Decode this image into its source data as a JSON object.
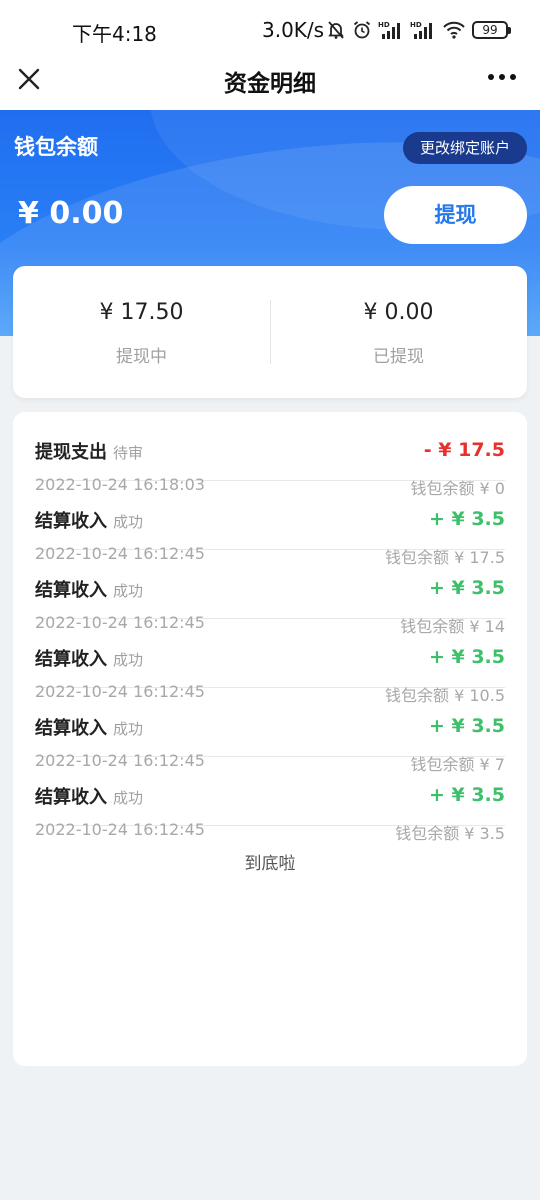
{
  "status_bar": {
    "time": "下午4:18",
    "net_speed": "3.0K/s",
    "battery": "99"
  },
  "nav": {
    "title": "资金明细"
  },
  "wallet": {
    "label": "钱包余额",
    "rebind_button": "更改绑定账户",
    "balance": "¥ 0.00",
    "withdraw_button": "提现"
  },
  "summary": {
    "pending": {
      "amount": "¥ 17.50",
      "label": "提现中"
    },
    "done": {
      "amount": "¥ 0.00",
      "label": "已提现"
    }
  },
  "records": [
    {
      "title": "提现支出",
      "status": "待审",
      "amount": "- ¥ 17.5",
      "time": "2022-10-24 16:18:03",
      "balance": "钱包余额 ¥ 0"
    },
    {
      "title": "结算收入",
      "status": "成功",
      "amount": "+ ¥ 3.5",
      "time": "2022-10-24 16:12:45",
      "balance": "钱包余额 ¥ 17.5"
    },
    {
      "title": "结算收入",
      "status": "成功",
      "amount": "+ ¥ 3.5",
      "time": "2022-10-24 16:12:45",
      "balance": "钱包余额 ¥ 14"
    },
    {
      "title": "结算收入",
      "status": "成功",
      "amount": "+ ¥ 3.5",
      "time": "2022-10-24 16:12:45",
      "balance": "钱包余额 ¥ 10.5"
    },
    {
      "title": "结算收入",
      "status": "成功",
      "amount": "+ ¥ 3.5",
      "time": "2022-10-24 16:12:45",
      "balance": "钱包余额 ¥ 7"
    },
    {
      "title": "结算收入",
      "status": "成功",
      "amount": "+ ¥ 3.5",
      "time": "2022-10-24 16:12:45",
      "balance": "钱包余额 ¥ 3.5"
    }
  ],
  "end_text": "到底啦",
  "colors": {
    "accent": "#2677e8",
    "negative": "#e8302c",
    "positive": "#3ec06a"
  }
}
